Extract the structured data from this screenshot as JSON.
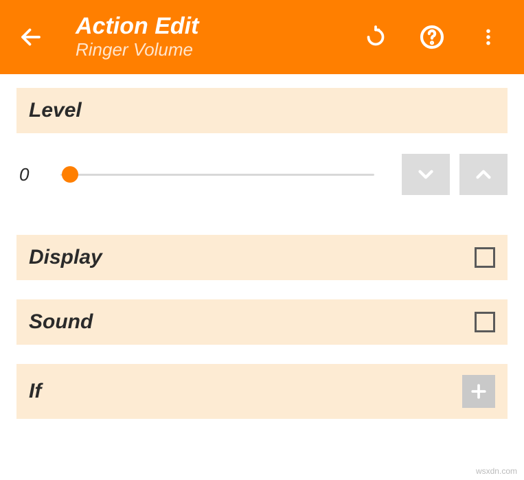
{
  "toolbar": {
    "title": "Action Edit",
    "subtitle": "Ringer Volume"
  },
  "sections": {
    "level": {
      "label": "Level",
      "value": "0"
    },
    "display": {
      "label": "Display",
      "checked": false
    },
    "sound": {
      "label": "Sound",
      "checked": false
    },
    "if": {
      "label": "If"
    }
  },
  "watermark": "wsxdn.com"
}
